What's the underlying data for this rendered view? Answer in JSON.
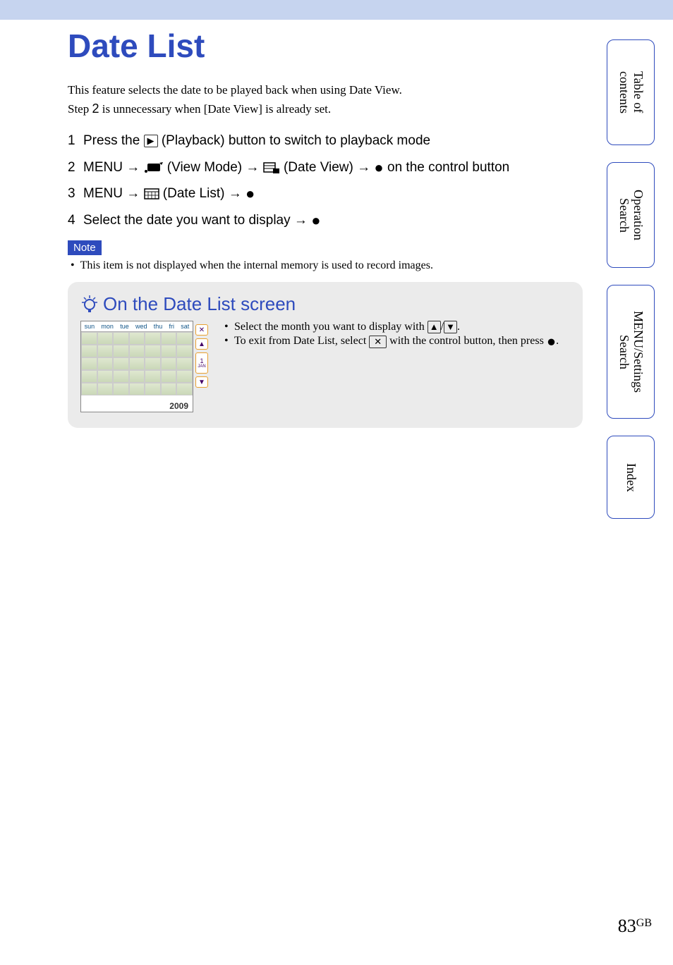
{
  "header": {
    "title": "Date List"
  },
  "intro": {
    "line1": "This feature selects the date to be played back when using Date View.",
    "line2_a": "Step ",
    "line2_num": "2",
    "line2_b": " is unnecessary when [Date View] is already set."
  },
  "steps": {
    "s1": {
      "num": "1",
      "a": "Press the ",
      "b": " (Playback) button to switch to playback mode"
    },
    "s2": {
      "num": "2",
      "a": "MENU ",
      "b": " (View Mode) ",
      "c": " (Date View) ",
      "d": " on the control button"
    },
    "s3": {
      "num": "3",
      "a": "MENU ",
      "b": " (Date List) "
    },
    "s4": {
      "num": "4",
      "a": "Select the date you want to display "
    }
  },
  "note": {
    "label": "Note",
    "text": "This item is not displayed when the internal memory is used to record images."
  },
  "tip": {
    "title": "On the Date List screen",
    "b1a": "Select the month you want to display with ",
    "b1b": "/",
    "b1c": ".",
    "b2a": "To exit from Date List, select ",
    "b2b": " with the control button, then press ",
    "b2c": "."
  },
  "calendar": {
    "days": [
      "sun",
      "mon",
      "tue",
      "wed",
      "thu",
      "fri",
      "sat"
    ],
    "side_close": "✕",
    "side_up": "▲",
    "side_big_num": "1",
    "side_big_mon": "JAN",
    "side_down": "▼",
    "year": "2009"
  },
  "sidetabs": {
    "t1a": "Table of",
    "t1b": "contents",
    "t2a": "Operation",
    "t2b": "Search",
    "t3a": "MENU/Settings",
    "t3b": "Search",
    "t4a": "Index"
  },
  "glyphs": {
    "arrow": "→",
    "dot": "●",
    "play": "▶",
    "up": "▲",
    "down": "▼",
    "x": "✕"
  },
  "page": {
    "num": "83",
    "suffix": "GB"
  }
}
